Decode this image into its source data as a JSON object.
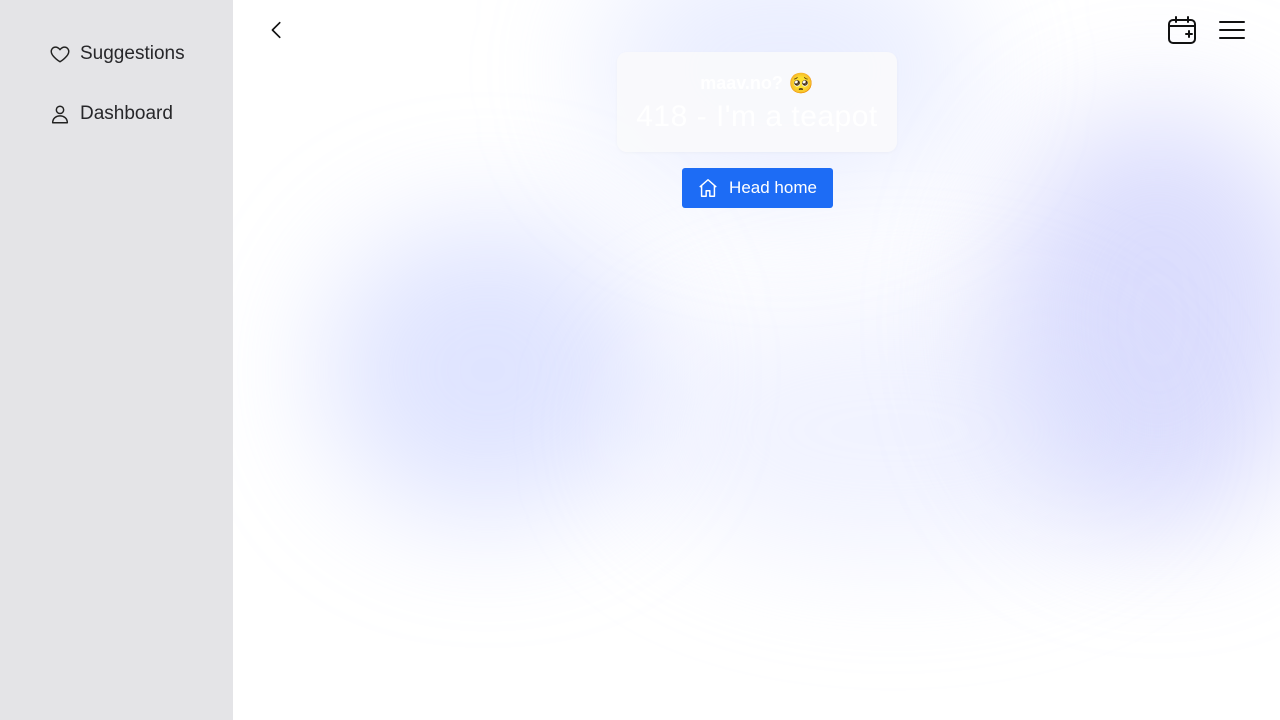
{
  "sidebar": {
    "items": [
      {
        "label": "Suggestions",
        "icon": "heart-icon"
      },
      {
        "label": "Dashboard",
        "icon": "user-icon"
      }
    ]
  },
  "topbar": {
    "back_icon": "chevron-left-icon",
    "calendar_icon": "calendar-add-icon",
    "menu_icon": "hamburger-menu-icon"
  },
  "card": {
    "brand": "maav.no?",
    "emoji": "🥺",
    "title": "418 - I'm a teapot"
  },
  "home_button": {
    "label": "Head home",
    "icon": "home-icon"
  },
  "colors": {
    "sidebar_bg": "#e4e4e7",
    "accent": "#1d6cf5"
  }
}
